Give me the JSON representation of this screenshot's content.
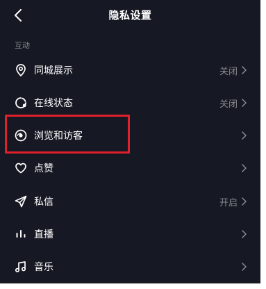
{
  "header": {
    "title": "隐私设置",
    "back_icon": "chevron-left-icon"
  },
  "section": {
    "title": "互动"
  },
  "items": [
    {
      "label": "同城展示",
      "status": "关闭",
      "icon": "location-pin-icon"
    },
    {
      "label": "在线状态",
      "status": "关闭",
      "icon": "online-status-icon"
    },
    {
      "label": "浏览和访客",
      "status": "",
      "icon": "eye-icon"
    },
    {
      "label": "点赞",
      "status": "",
      "icon": "heart-icon"
    },
    {
      "label": "私信",
      "status": "开启",
      "icon": "send-icon"
    },
    {
      "label": "直播",
      "status": "",
      "icon": "live-bars-icon"
    },
    {
      "label": "音乐",
      "status": "",
      "icon": "music-note-icon"
    }
  ],
  "colors": {
    "background": "#161823",
    "text": "#ffffff",
    "muted": "#8a8b91",
    "highlight": "#e0202a"
  }
}
